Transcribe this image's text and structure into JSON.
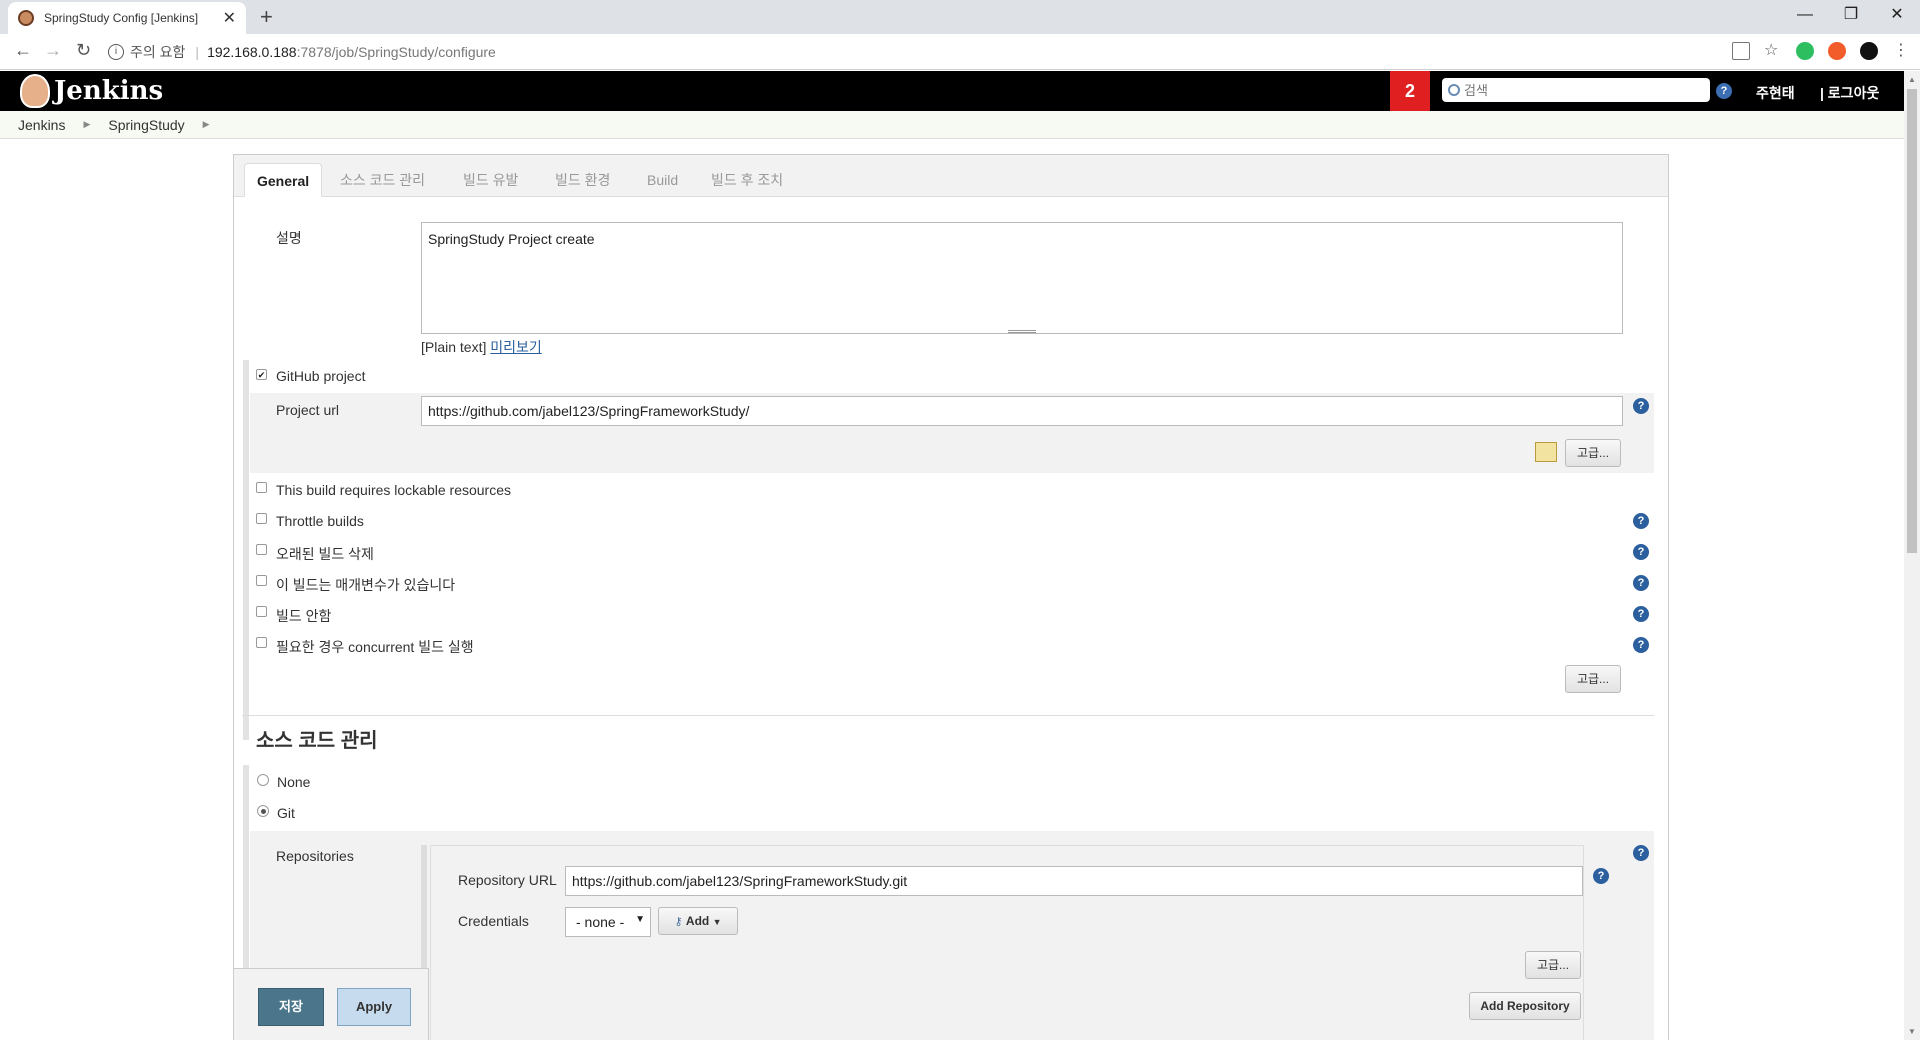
{
  "browser": {
    "tab_title": "SpringStudy Config [Jenkins]",
    "tab_close": "✕",
    "new_tab": "+",
    "url_warning": "주의 요함",
    "url_host": "192.168.0.188",
    "url_path": ":7878/job/SpringStudy/configure",
    "window_controls": [
      "—",
      "❐",
      "✕"
    ]
  },
  "jenkins": {
    "logo_text": "Jenkins",
    "notification_count": "2",
    "search_placeholder": "검색",
    "help": "?",
    "user": "주현태",
    "logout": "| 로그아웃"
  },
  "breadcrumbs": [
    "Jenkins",
    "SpringStudy"
  ],
  "tabs": [
    "General",
    "소스 코드 관리",
    "빌드 유발",
    "빌드 환경",
    "Build",
    "빌드 후 조치"
  ],
  "general": {
    "description_label": "설명",
    "description_value": "SpringStudy Project create",
    "plain_text": "[Plain text]",
    "preview_link": "미리보기",
    "github_project_label": "GitHub project",
    "project_url_label": "Project url",
    "project_url_value": "https://github.com/jabel123/SpringFrameworkStudy/",
    "advanced_label": "고급...",
    "options": [
      "This build requires lockable resources",
      "Throttle builds",
      "오래된 빌드 삭제",
      "이 빌드는 매개변수가 있습니다",
      "빌드 안함",
      "필요한 경우 concurrent 빌드 실행"
    ]
  },
  "scm": {
    "heading": "소스 코드 관리",
    "none_label": "None",
    "git_label": "Git",
    "repositories_label": "Repositories",
    "repo_url_label": "Repository URL",
    "repo_url_value": "https://github.com/jabel123/SpringFrameworkStudy.git",
    "credentials_label": "Credentials",
    "credentials_value": "- none -",
    "add_label": "Add",
    "advanced_label": "고급...",
    "add_repository_label": "Add Repository"
  },
  "actions": {
    "save_label": "저장",
    "apply_label": "Apply"
  },
  "colors": {
    "header_bg": "#000000",
    "badge": "#e02020",
    "save_button": "#4b758b",
    "apply_button": "#c6dbee",
    "help_icon": "#2b5f9e"
  }
}
